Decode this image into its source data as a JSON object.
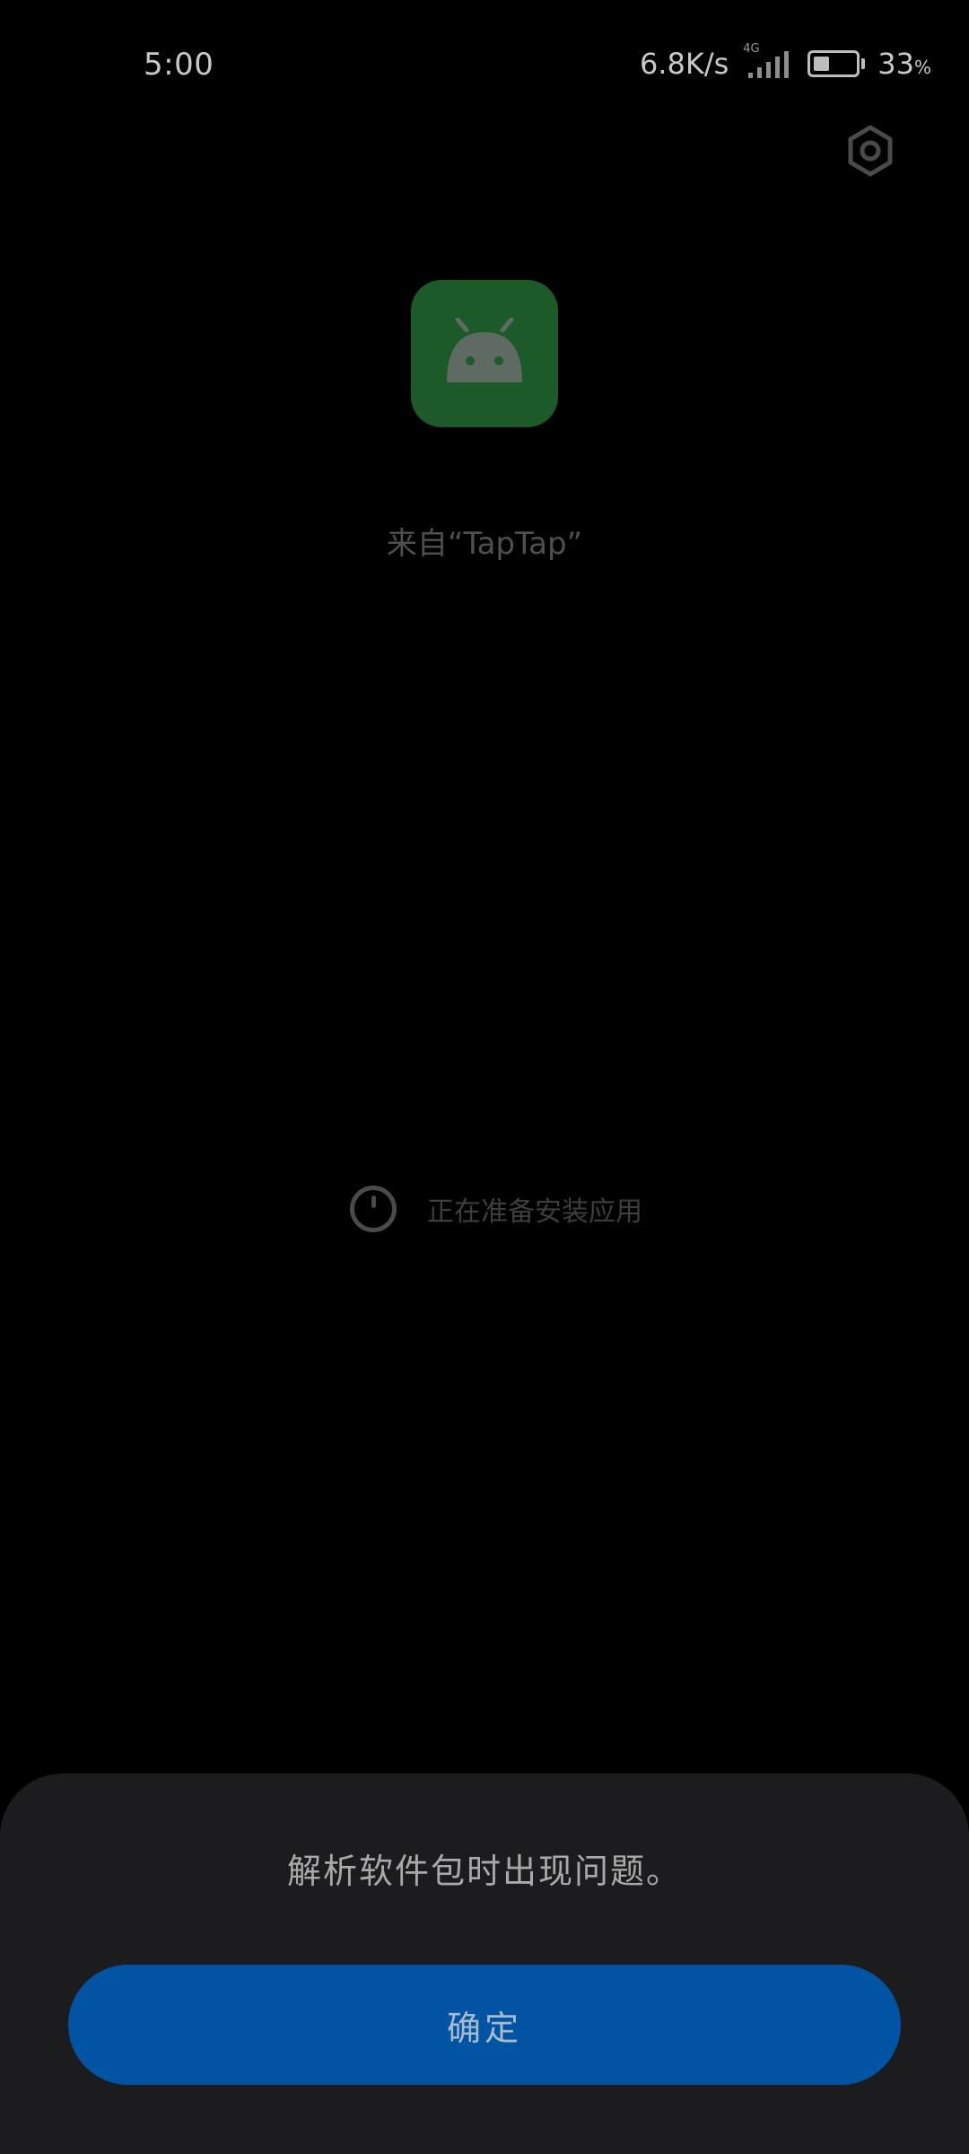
{
  "status_bar": {
    "time": "5:00",
    "net_speed": "6.8K/s",
    "network_type": "4G",
    "signal_sub": "ıl",
    "battery_percent": "33",
    "battery_suffix": "%",
    "battery_level": 0.33
  },
  "header": {
    "settings_icon": "gear-icon"
  },
  "app": {
    "icon": "android-icon",
    "icon_bg_color": "#1c5a2a",
    "source_label": "来自“TapTap”"
  },
  "progress": {
    "icon": "spinner-icon",
    "text": "正在准备安装应用"
  },
  "dialog": {
    "message": "解析软件包时出现问题。",
    "confirm_label": "确定",
    "button_color": "#0054a3"
  }
}
